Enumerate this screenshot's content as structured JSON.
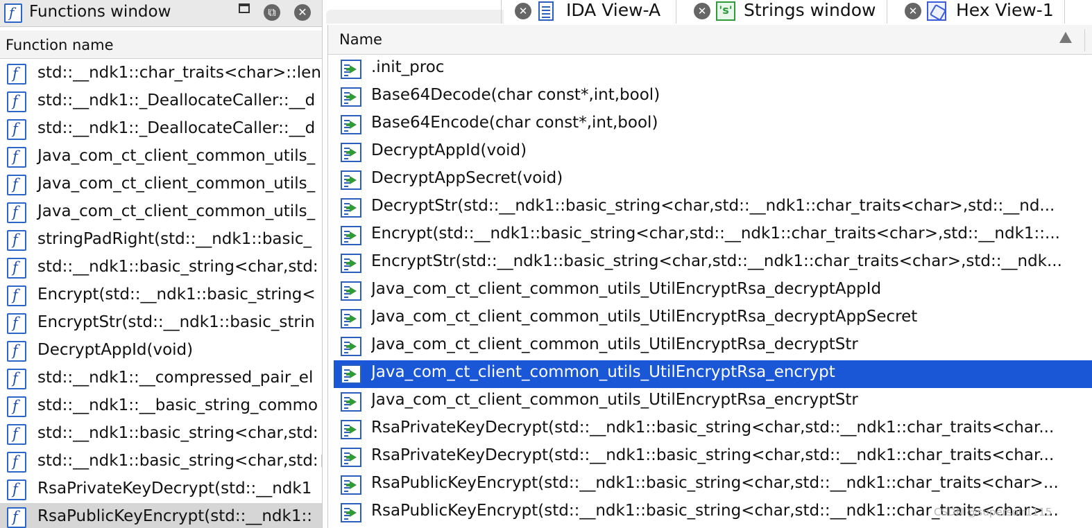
{
  "left_panel": {
    "title": "Functions window",
    "column_header": "Function name",
    "icon_glyph": "f",
    "rows": [
      "std::__ndk1::char_traits<char>::len",
      "std::__ndk1::_DeallocateCaller::__d",
      "std::__ndk1::_DeallocateCaller::__d",
      "Java_com_ct_client_common_utils_",
      "Java_com_ct_client_common_utils_",
      "Java_com_ct_client_common_utils_",
      "stringPadRight(std::__ndk1::basic_",
      "std::__ndk1::basic_string<char,std:",
      "Encrypt(std::__ndk1::basic_string<",
      "EncryptStr(std::__ndk1::basic_strin",
      "DecryptAppId(void)",
      "std::__ndk1::__compressed_pair_el",
      "std::__ndk1::__basic_string_commo",
      "std::__ndk1::basic_string<char,std:",
      "std::__ndk1::basic_string<char,std:",
      "RsaPrivateKeyDecrypt(std::__ndk1",
      "RsaPublicKeyEncrypt(std::__ndk1::"
    ],
    "selected_index": 16
  },
  "tabs": [
    {
      "label": "IDA View-A",
      "icon": "ida-view-icon"
    },
    {
      "label": "Strings window",
      "icon": "strings-icon",
      "icon_glyph": "'s'"
    },
    {
      "label": "Hex View-1",
      "icon": "hex-view-icon"
    }
  ],
  "close_glyph": "✕",
  "restore_glyph": "⧉",
  "right_panel": {
    "column_header": "Name",
    "rows": [
      ".init_proc",
      "Base64Decode(char const*,int,bool)",
      "Base64Encode(char const*,int,bool)",
      "DecryptAppId(void)",
      "DecryptAppSecret(void)",
      "DecryptStr(std::__ndk1::basic_string<char,std::__ndk1::char_traits<char>,std::__nd...",
      "Encrypt(std::__ndk1::basic_string<char,std::__ndk1::char_traits<char>,std::__ndk1::...",
      "EncryptStr(std::__ndk1::basic_string<char,std::__ndk1::char_traits<char>,std::__ndk...",
      "Java_com_ct_client_common_utils_UtilEncryptRsa_decryptAppId",
      "Java_com_ct_client_common_utils_UtilEncryptRsa_decryptAppSecret",
      "Java_com_ct_client_common_utils_UtilEncryptRsa_decryptStr",
      "Java_com_ct_client_common_utils_UtilEncryptRsa_encrypt",
      "Java_com_ct_client_common_utils_UtilEncryptRsa_encryptStr",
      "RsaPrivateKeyDecrypt(std::__ndk1::basic_string<char,std::__ndk1::char_traits<char...",
      "RsaPrivateKeyDecrypt(std::__ndk1::basic_string<char,std::__ndk1::char_traits<char...",
      "RsaPublicKeyEncrypt(std::__ndk1::basic_string<char,std::__ndk1::char_traits<char>...",
      "RsaPublicKeyEncrypt(std::__ndk1::basic_string<char,std::__ndk1::char_traits<char>..."
    ],
    "selected_index": 11
  },
  "watermark": "CSDN @supersolr1115",
  "colors": {
    "selection_blue": "#1a57d6",
    "selection_gray": "#d6d6d6",
    "icon_blue": "#2a5fbf",
    "icon_green": "#2e9a3a"
  }
}
